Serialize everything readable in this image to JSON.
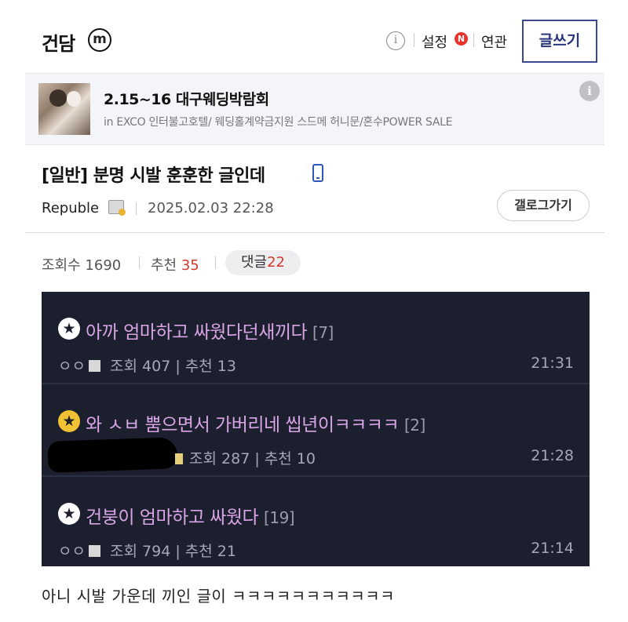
{
  "header": {
    "gallery_title": "건담",
    "mini_badge": "m",
    "info_glyph": "i",
    "setting_label": "설정",
    "new_badge": "N",
    "related_label": "연관",
    "write_label": "글쓰기"
  },
  "ad": {
    "title": "2.15~16 대구웨딩박람회",
    "description": "in EXCO 인터불고호텔/ 웨딩홀계약금지원 스드메 허니문/혼수POWER SALE",
    "info_glyph": "i"
  },
  "post": {
    "title": "[일반] 분명 시발 훈훈한 글인데",
    "author": "Republe",
    "date": "2025.02.03 22:28",
    "gallog_label": "갤로그가기",
    "views_label": "조회수",
    "views": "1690",
    "recommend_label": "추천",
    "recommend": "35",
    "comments_label": "댓글",
    "comments": "22",
    "body": "아니 시발 가운데 끼인 글이 ㅋㅋㅋㅋㅋㅋㅋㅋㅋㅋㅋ"
  },
  "embedded_list": [
    {
      "title": "아까 엄마하고 싸웠다던새끼다",
      "count": "[7]",
      "writer": "ㅇㅇ",
      "views_label": "조회",
      "views": "407",
      "recommend_label": "추천",
      "recommend": "13",
      "time": "21:31"
    },
    {
      "title": "와 ㅅㅂ 뿜으면서 가버리네 씹년이ㅋㅋㅋㅋ",
      "count": "[2]",
      "writer": "",
      "views_label": "조회",
      "views": "287",
      "recommend_label": "추천",
      "recommend": "10",
      "time": "21:28"
    },
    {
      "title": "건붕이 엄마하고 싸웠다",
      "count": "[19]",
      "writer": "ㅇㅇ",
      "views_label": "조회",
      "views": "794",
      "recommend_label": "추천",
      "recommend": "21",
      "time": "21:14"
    }
  ],
  "colors": {
    "write_border": "#3b4890",
    "accent_red": "#d03a2c",
    "dark_bg": "#1c1f2e",
    "dark_title": "#d9a5e6"
  }
}
